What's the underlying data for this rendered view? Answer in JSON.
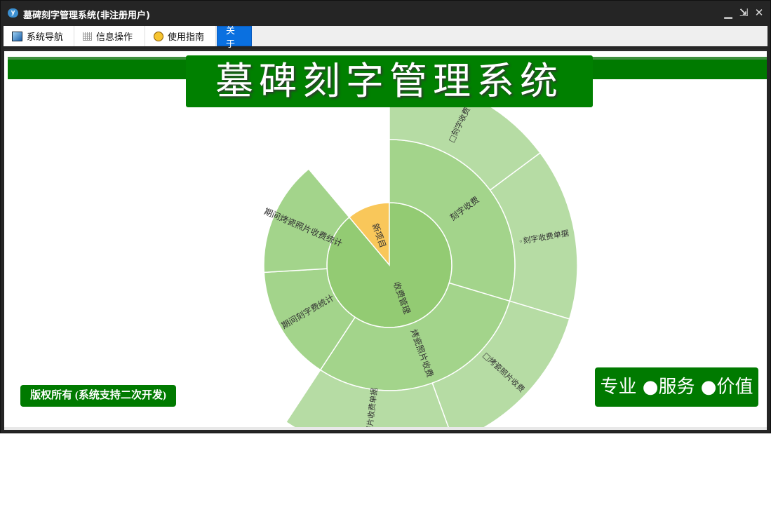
{
  "window": {
    "title": "墓碑刻字管理系统(非注册用户)",
    "app_icon": "cloud-logo-icon",
    "controls": [
      "minimize-icon",
      "restore-icon",
      "close-icon"
    ]
  },
  "tabs": [
    {
      "label": "系统导航",
      "icon": "navigation-window-icon",
      "active": false
    },
    {
      "label": "信息操作",
      "icon": "grid-icon",
      "active": false
    },
    {
      "label": "使用指南",
      "icon": "help-icon",
      "active": false
    },
    {
      "label": "关于",
      "active": true
    }
  ],
  "main": {
    "title": "墓碑刻字管理系统",
    "copyright": "版权所有 (系统支持二次开发)",
    "slogan": "专业 ●服务 ●价值"
  },
  "colors": {
    "brand_green": "#008000",
    "tab_active": "#0a70e0",
    "level1": "#93cb73",
    "level2": "#a3d48b",
    "level3": "#b6dca4",
    "new_item": "#f9c75a"
  },
  "chart_data": {
    "type": "sunburst",
    "nodes": [
      {
        "name": "新项目",
        "value": 1,
        "color": "#f9c75a"
      },
      {
        "name": "收费管理",
        "value": 8,
        "color": "#93cb73",
        "children": [
          {
            "name": "刻字收费",
            "value": 2,
            "children": [
              {
                "name": "□刻字收费",
                "value": 1
              },
              {
                "name": "◦刻字收费单据",
                "value": 1
              }
            ]
          },
          {
            "name": "烤瓷照片收费",
            "value": 2,
            "children": [
              {
                "name": "□烤瓷照片收费",
                "value": 1
              },
              {
                "name": "◦烤瓷照片收费单据",
                "value": 1
              }
            ]
          },
          {
            "name": "期间刻字费统计",
            "value": 1
          },
          {
            "name": "期间烤瓷照片收费统计",
            "value": 1
          }
        ]
      }
    ]
  }
}
